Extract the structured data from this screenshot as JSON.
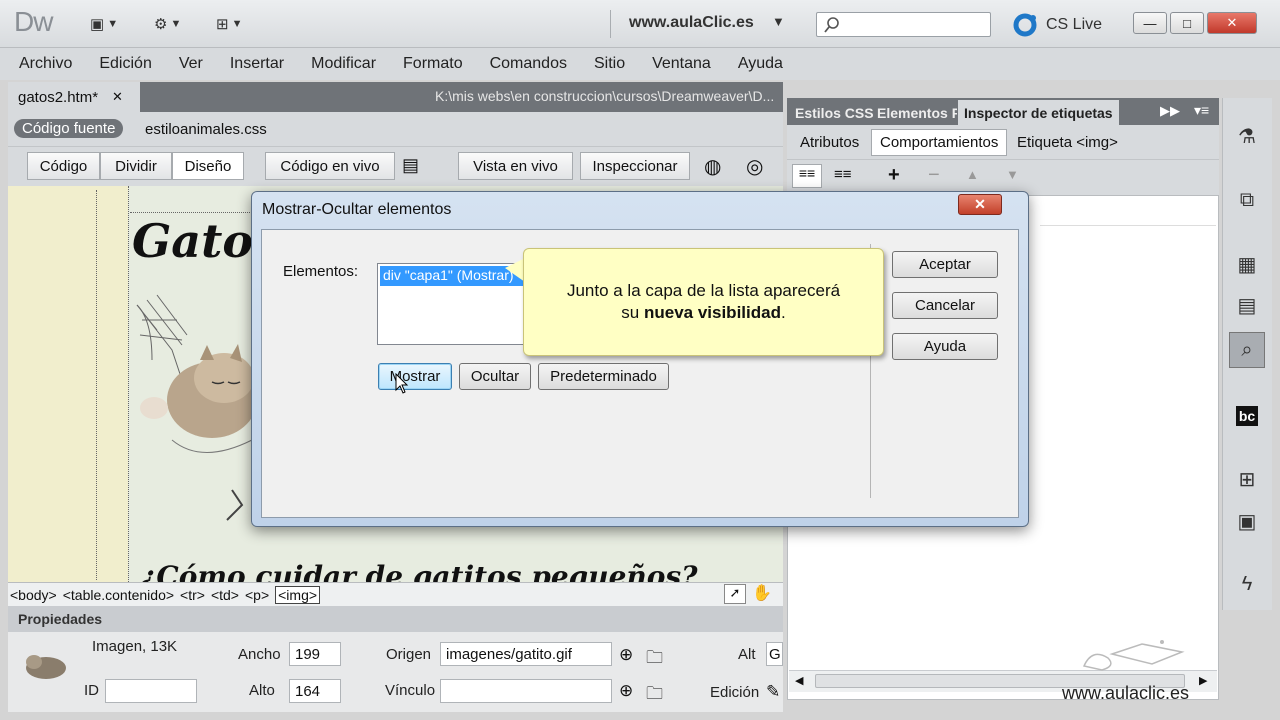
{
  "titlebar": {
    "logo": "Dw",
    "site": "www.aulaClic.es",
    "cs_live": "CS Live",
    "win_min": "—",
    "win_max": "□",
    "win_close": "✕"
  },
  "menu": [
    "Archivo",
    "Edición",
    "Ver",
    "Insertar",
    "Modificar",
    "Formato",
    "Comandos",
    "Sitio",
    "Ventana",
    "Ayuda"
  ],
  "document": {
    "tab_name": "gatos2.htm*",
    "tab_close": "✕",
    "path": "K:\\mis webs\\en construccion\\cursos\\Dreamweaver\\D...",
    "source_label": "Código fuente",
    "css_file": "estiloanimales.css"
  },
  "viewbar": {
    "codigo": "Código",
    "dividir": "Dividir",
    "diseno": "Diseño",
    "codigo_vivo": "Código en vivo",
    "vista_vivo": "Vista en vivo",
    "inspeccionar": "Inspeccionar"
  },
  "design": {
    "title": "Gatos",
    "bottom_text": "¿Cómo cuidar de gatitos pequeños?"
  },
  "tag_selector": [
    "<body>",
    "<table.contenido>",
    "<tr>",
    "<td>",
    "<p>",
    "<img>"
  ],
  "properties": {
    "header": "Propiedades",
    "type_size": "Imagen, 13K",
    "id_label": "ID",
    "id_value": "",
    "ancho_label": "Ancho",
    "ancho_value": "199",
    "alto_label": "Alto",
    "alto_value": "164",
    "origen_label": "Origen",
    "origen_value": "imagenes/gatito.gif",
    "vinculo_label": "Vínculo",
    "vinculo_value": "",
    "alt_label": "Alt",
    "alt_value": "G",
    "edicion_label": "Edición"
  },
  "right_panel": {
    "tabs": [
      "Estilos CSS",
      "Elementos P",
      "Inspector de etiquetas"
    ],
    "sub_buttons": [
      "Atributos",
      "Comportamientos"
    ],
    "tag_label": "Etiqueta <img>"
  },
  "dialog": {
    "title": "Mostrar-Ocultar elementos",
    "close": "✕",
    "elements_label": "Elementos:",
    "list_item": "div \"capa1\" (Mostrar)",
    "btn_mostrar": "Mostrar",
    "btn_ocultar": "Ocultar",
    "btn_predeterminado": "Predeterminado",
    "btn_aceptar": "Aceptar",
    "btn_cancelar": "Cancelar",
    "btn_ayuda": "Ayuda"
  },
  "callout": {
    "line1": "Junto a la capa de la lista aparecerá",
    "line2_pre": "su ",
    "line2_bold": "nueva visibilidad",
    "line2_post": "."
  },
  "watermark": "www.aulaclic.es",
  "colors": {
    "accent_blue": "#3399ff",
    "callout_bg": "#ffffc4",
    "close_red": "#c2402a"
  }
}
